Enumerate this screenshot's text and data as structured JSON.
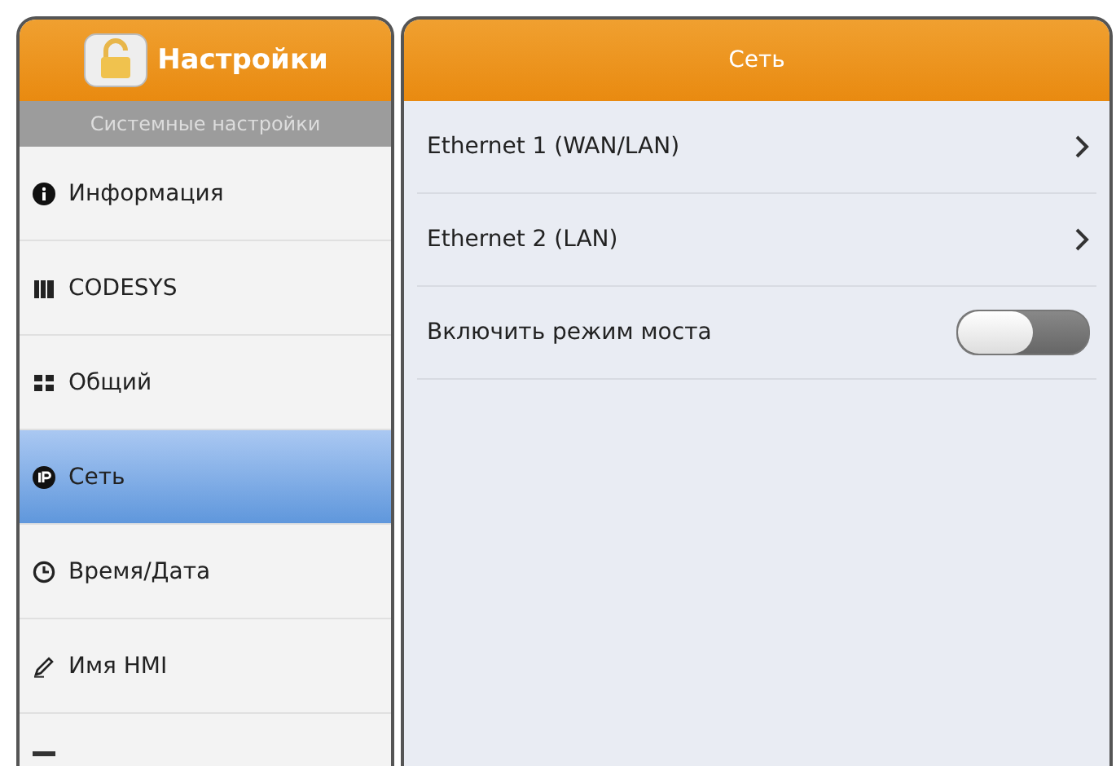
{
  "sidebar": {
    "title": "Настройки",
    "subtitle": "Системные настройки",
    "items": [
      {
        "label": "Информация",
        "selected": false
      },
      {
        "label": "CODESYS",
        "selected": false
      },
      {
        "label": "Общий",
        "selected": false
      },
      {
        "label": "Сеть",
        "selected": true
      },
      {
        "label": "Время/Дата",
        "selected": false
      },
      {
        "label": "Имя HMI",
        "selected": false
      }
    ]
  },
  "detail": {
    "title": "Сеть",
    "rows": [
      {
        "kind": "link",
        "label": "Ethernet 1 (WAN/LAN)"
      },
      {
        "kind": "link",
        "label": "Ethernet 2 (LAN)"
      },
      {
        "kind": "toggle",
        "label": "Включить режим моста",
        "on": false
      }
    ]
  }
}
